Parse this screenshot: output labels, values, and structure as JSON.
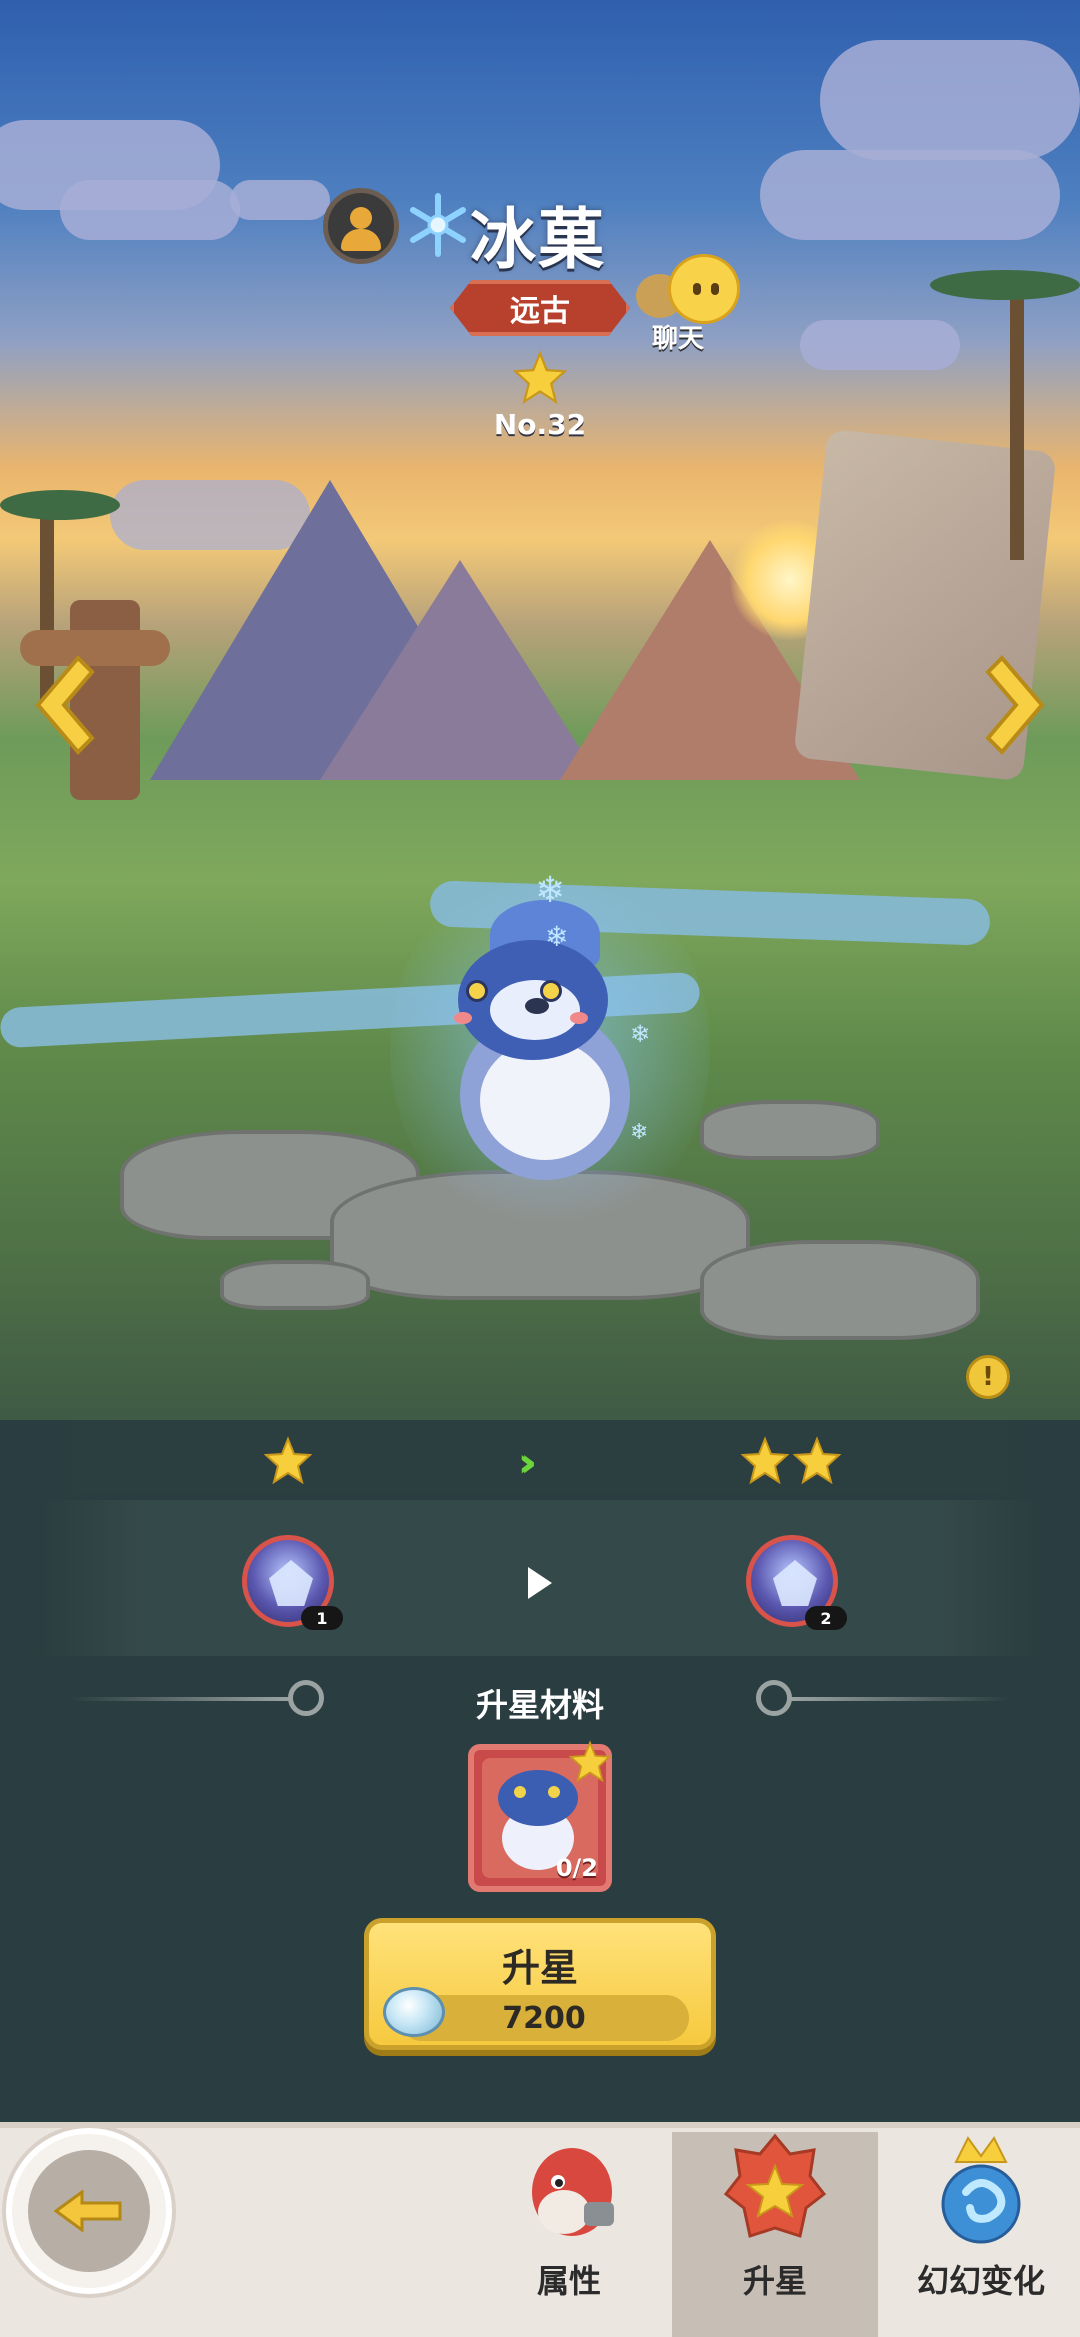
{
  "pet": {
    "name": "冰菓",
    "rarity": "远古",
    "number": "No.32",
    "stars": 1,
    "element_icon": "snowflake-icon"
  },
  "header": {
    "chat_label": "聊天",
    "avatar_icon": "user-silhouette-icon"
  },
  "upgrade": {
    "current_stars": 1,
    "next_stars": 2,
    "current_skill_level": "1",
    "next_skill_level": "2",
    "materials_title": "升星材料",
    "material_count": "0/2",
    "button_label": "升星",
    "cost": "7200",
    "cost_icon": "shell-gem-icon",
    "info_icon": "exclamation-icon"
  },
  "nav": {
    "back_icon": "back-arrow-icon",
    "tabs": [
      {
        "label": "属性",
        "icon": "dinosaur-icon",
        "active": false
      },
      {
        "label": "升星",
        "icon": "star-badge-icon",
        "active": true
      },
      {
        "label": "幻幻变化",
        "icon": "swirl-crown-icon",
        "active": false
      }
    ]
  },
  "colors": {
    "accent_gold": "#f6c93e",
    "rarity_red": "#b8412e",
    "chevron_green": "#6bd43b"
  }
}
